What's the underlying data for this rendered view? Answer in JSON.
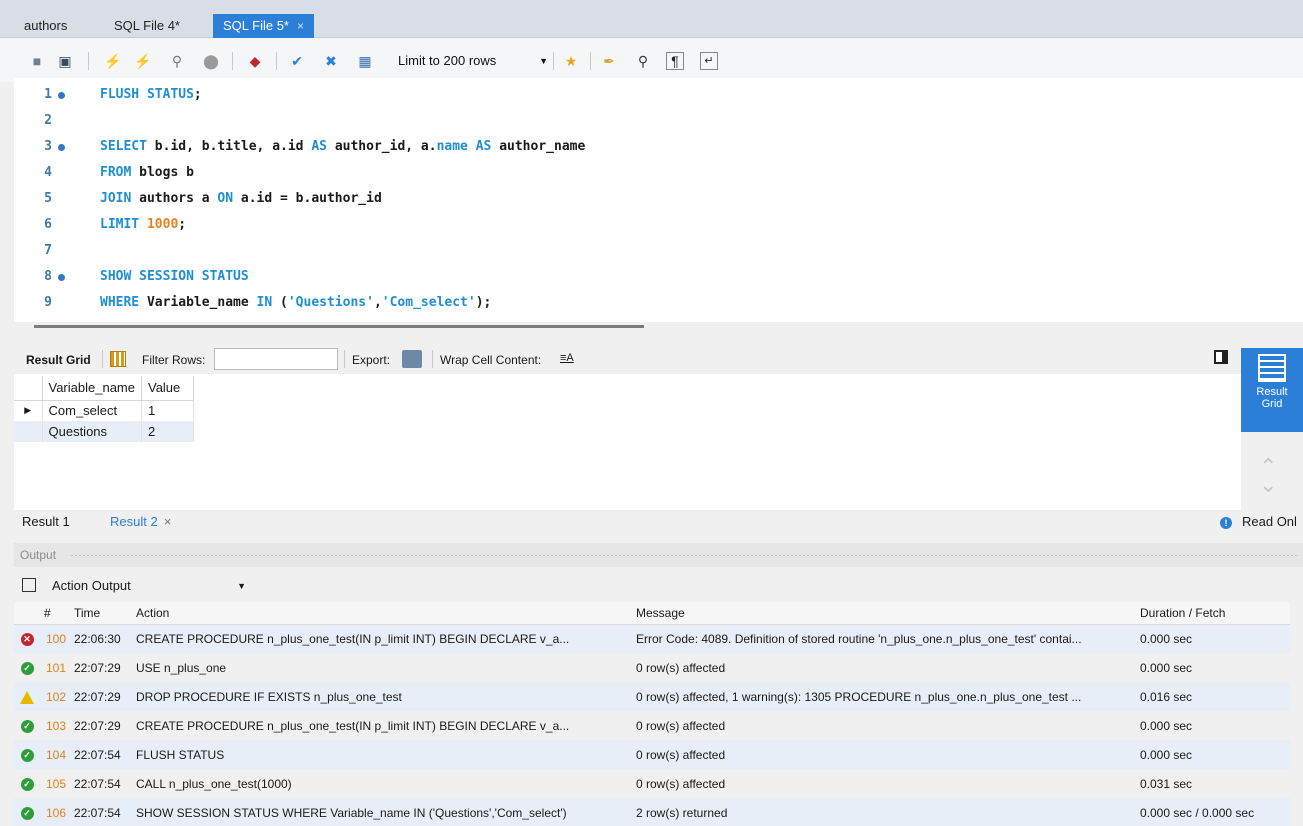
{
  "tabs": [
    {
      "label": "authors",
      "active": false
    },
    {
      "label": "SQL File 4*",
      "active": false
    },
    {
      "label": "SQL File 5*",
      "active": true,
      "close": "×"
    }
  ],
  "toolbar": {
    "limit_label": "Limit to 200 rows",
    "icons": [
      "open-folder-icon",
      "save-icon",
      "execute-icon",
      "execute-current-icon",
      "explain-icon",
      "stop-icon",
      "toggle-error-icon",
      "commit-icon",
      "rollback-icon",
      "autocommit-icon",
      "add-snippet-icon",
      "beautify-icon",
      "find-icon",
      "invisible-chars-icon",
      "wrap-lines-icon"
    ]
  },
  "editor": {
    "lines": [
      {
        "n": "1",
        "dot": true
      },
      {
        "n": "2",
        "dot": false
      },
      {
        "n": "3",
        "dot": true
      },
      {
        "n": "4",
        "dot": false
      },
      {
        "n": "5",
        "dot": false
      },
      {
        "n": "6",
        "dot": false
      },
      {
        "n": "7",
        "dot": false
      },
      {
        "n": "8",
        "dot": true
      },
      {
        "n": "9",
        "dot": false
      }
    ],
    "code": [
      [
        {
          "t": "FLUSH STATUS",
          "c": "kw"
        },
        {
          "t": ";",
          "c": ""
        }
      ],
      [],
      [
        {
          "t": "SELECT",
          "c": "kw"
        },
        {
          "t": " b.id, b.title, a.id ",
          "c": ""
        },
        {
          "t": "AS",
          "c": "kw"
        },
        {
          "t": " author_id, a.",
          "c": ""
        },
        {
          "t": "name",
          "c": "kw"
        },
        {
          "t": " ",
          "c": ""
        },
        {
          "t": "AS",
          "c": "kw"
        },
        {
          "t": " author_name",
          "c": ""
        }
      ],
      [
        {
          "t": "FROM",
          "c": "kw"
        },
        {
          "t": " blogs b",
          "c": ""
        }
      ],
      [
        {
          "t": "JOIN",
          "c": "kw"
        },
        {
          "t": " authors a ",
          "c": ""
        },
        {
          "t": "ON",
          "c": "kw"
        },
        {
          "t": " a.id = b.author_id",
          "c": ""
        }
      ],
      [
        {
          "t": "LIMIT",
          "c": "kw"
        },
        {
          "t": " ",
          "c": ""
        },
        {
          "t": "1000",
          "c": "num"
        },
        {
          "t": ";",
          "c": ""
        }
      ],
      [],
      [
        {
          "t": "SHOW SESSION STATUS",
          "c": "kw"
        }
      ],
      [
        {
          "t": "WHERE",
          "c": "kw"
        },
        {
          "t": " Variable_name ",
          "c": ""
        },
        {
          "t": "IN",
          "c": "kw"
        },
        {
          "t": " (",
          "c": ""
        },
        {
          "t": "'Questions'",
          "c": "str"
        },
        {
          "t": ",",
          "c": ""
        },
        {
          "t": "'Com_select'",
          "c": "str"
        },
        {
          "t": ");",
          "c": ""
        }
      ]
    ]
  },
  "result_toolbar": {
    "result_grid_label": "Result Grid",
    "filter_rows_label": "Filter Rows:",
    "filter_value": "",
    "export_label": "Export:",
    "wrap_label": "Wrap Cell Content:"
  },
  "result_grid": {
    "columns": [
      "Variable_name",
      "Value"
    ],
    "rows": [
      [
        "Com_select",
        "1"
      ],
      [
        "Questions",
        "2"
      ]
    ]
  },
  "side_panel": {
    "result_grid_label_1": "Result",
    "result_grid_label_2": "Grid"
  },
  "result_tabs": [
    {
      "label": "Result 1",
      "active": false
    },
    {
      "label": "Result 2",
      "active": true,
      "close": "×"
    }
  ],
  "read_only_label": "Read Onl",
  "output": {
    "header": "Output",
    "select_value": "Action Output",
    "columns": [
      "",
      "#",
      "Time",
      "Action",
      "Message",
      "Duration / Fetch"
    ],
    "rows": [
      {
        "status": "err",
        "num": "100",
        "time": "22:06:30",
        "action": "CREATE PROCEDURE n_plus_one_test(IN p_limit INT) BEGIN   DECLARE v_a...",
        "message": "Error Code: 4089. Definition of stored routine 'n_plus_one.n_plus_one_test' contai...",
        "duration": "0.000 sec"
      },
      {
        "status": "ok",
        "num": "101",
        "time": "22:07:29",
        "action": "USE n_plus_one",
        "message": "0 row(s) affected",
        "duration": "0.000 sec"
      },
      {
        "status": "warn",
        "num": "102",
        "time": "22:07:29",
        "action": "DROP PROCEDURE IF EXISTS n_plus_one_test",
        "message": "0 row(s) affected, 1 warning(s): 1305 PROCEDURE n_plus_one.n_plus_one_test ...",
        "duration": "0.016 sec"
      },
      {
        "status": "ok",
        "num": "103",
        "time": "22:07:29",
        "action": "CREATE PROCEDURE n_plus_one_test(IN p_limit INT) BEGIN   DECLARE v_a...",
        "message": "0 row(s) affected",
        "duration": "0.000 sec"
      },
      {
        "status": "ok",
        "num": "104",
        "time": "22:07:54",
        "action": "FLUSH STATUS",
        "message": "0 row(s) affected",
        "duration": "0.000 sec"
      },
      {
        "status": "ok",
        "num": "105",
        "time": "22:07:54",
        "action": "CALL n_plus_one_test(1000)",
        "message": "0 row(s) affected",
        "duration": "0.031 sec"
      },
      {
        "status": "ok",
        "num": "106",
        "time": "22:07:54",
        "action": "SHOW SESSION STATUS WHERE Variable_name IN ('Questions','Com_select')",
        "message": "2 row(s) returned",
        "duration": "0.000 sec / 0.000 sec"
      }
    ]
  },
  "colors": {
    "accent": "#2b7fd6",
    "keyword": "#1f8fd2",
    "number": "#e0831f",
    "ok": "#2e9d3a",
    "error": "#c3262c",
    "warning": "#e6b800"
  }
}
